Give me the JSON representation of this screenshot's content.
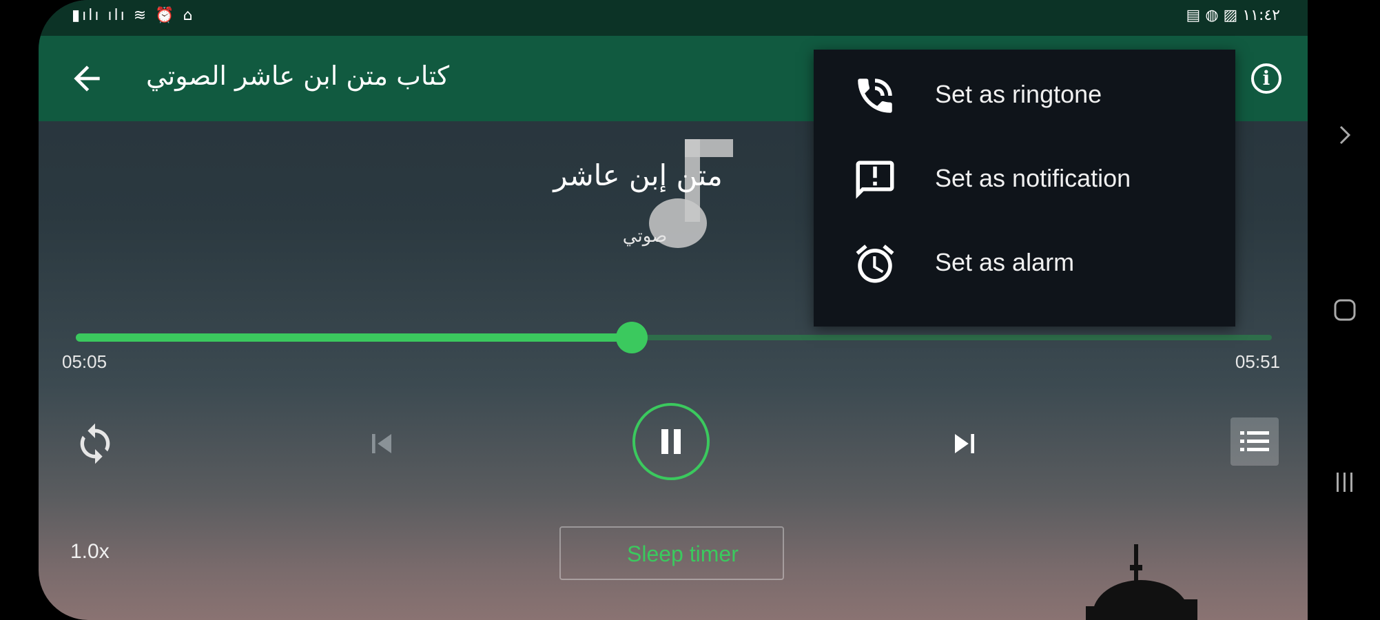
{
  "status_bar": {
    "left_icons": "▮ılı ılı ≋ ⏰ ⌂",
    "right_icons": "▤ ◍ ▨",
    "time": "١١:٤٢"
  },
  "app_bar": {
    "title": "كتاب متن ابن عاشر الصوتي",
    "back_icon": "arrow-left-icon",
    "info_icon": "info-icon"
  },
  "track": {
    "title": "متن إبن عاشر",
    "artist": "صوتي",
    "art_icon": "music-note-icon"
  },
  "menu": {
    "items": [
      {
        "label": "Set as ringtone",
        "icon": "phone-ringing-icon"
      },
      {
        "label": "Set as notification",
        "icon": "notification-alert-icon"
      },
      {
        "label": "Set as alarm",
        "icon": "alarm-clock-icon"
      }
    ]
  },
  "player": {
    "elapsed": "05:05",
    "total": "05:51",
    "progress_fraction": 0.465,
    "speed": "1.0x",
    "sleep_timer_label": "Sleep timer",
    "state": "playing"
  },
  "colors": {
    "accent": "#3bc95e",
    "app_bar": "#115a40",
    "status_bar": "#0c3326",
    "menu_bg": "#0f141a"
  }
}
